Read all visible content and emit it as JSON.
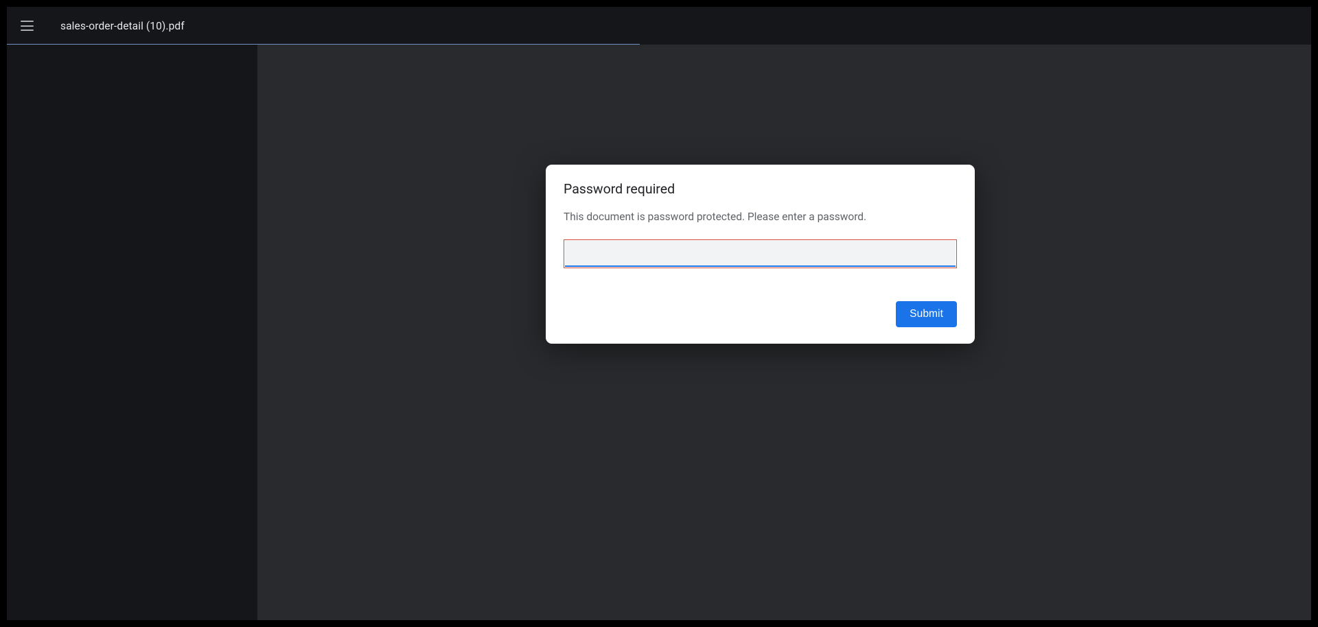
{
  "toolbar": {
    "filename": "sales-order-detail (10).pdf"
  },
  "dialog": {
    "title": "Password required",
    "message": "This document is password protected. Please enter a password.",
    "password_value": "",
    "submit_label": "Submit"
  }
}
